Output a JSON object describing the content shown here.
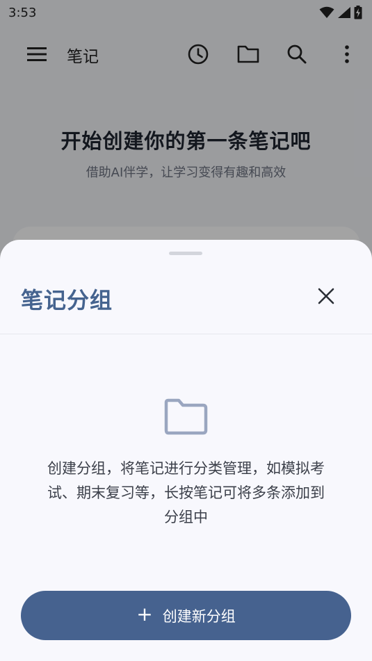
{
  "status_bar": {
    "time": "3:53",
    "icons": [
      "wifi-icon",
      "cellular-signal-icon",
      "battery-charging-icon"
    ]
  },
  "app_bar": {
    "title": "笔记",
    "icons": [
      "menu-icon",
      "history-clock-icon",
      "folder-icon",
      "search-icon",
      "more-vert-icon"
    ]
  },
  "background": {
    "hero_title": "开始创建你的第一条笔记吧",
    "hero_subtitle": "借助AI伴学，让学习变得有趣和高效"
  },
  "sheet": {
    "title": "笔记分组",
    "close_icon": "close-icon",
    "empty_icon": "folder-outline-icon",
    "empty_text": "创建分组，将笔记进行分类管理，如模拟考试、期末复习等，长按笔记可将多条添加到分组中",
    "create_button_icon": "plus-icon",
    "create_button_label": "创建新分组"
  },
  "colors": {
    "accent": "#46628f",
    "title": "#45638f",
    "sheet_background": "#f8f8fd",
    "folder_icon": "#9aa6c0"
  }
}
